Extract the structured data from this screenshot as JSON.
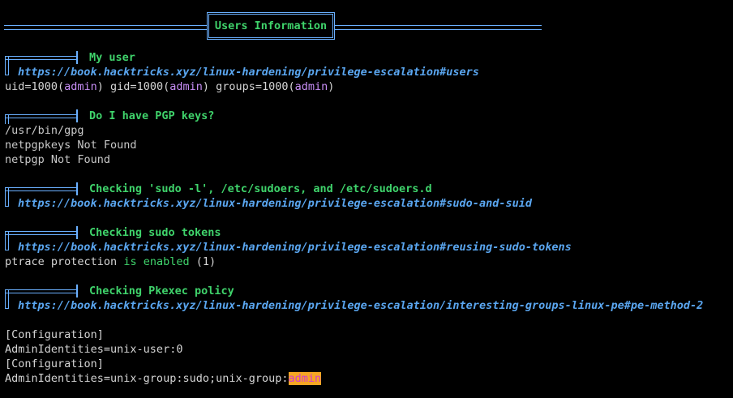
{
  "banner": {
    "title": "Users Information"
  },
  "sections": [
    {
      "title": "My user",
      "link": "https://book.hacktricks.xyz/linux-hardening/privilege-escalation#users",
      "output": {
        "uid_prefix": "uid=1000(",
        "uid_name": "admin",
        "gid_prefix": ") gid=1000(",
        "gid_name": "admin",
        "groups_prefix": ") groups=1000(",
        "groups_name": "admin",
        "suffix": ")"
      }
    },
    {
      "title": "Do I have PGP keys?",
      "lines": [
        "/usr/bin/gpg",
        "netpgpkeys Not Found",
        "netpgp Not Found"
      ]
    },
    {
      "title": "Checking 'sudo -l', /etc/sudoers, and /etc/sudoers.d",
      "link": "https://book.hacktricks.xyz/linux-hardening/privilege-escalation#sudo-and-suid"
    },
    {
      "title": "Checking sudo tokens",
      "link": "https://book.hacktricks.xyz/linux-hardening/privilege-escalation#reusing-sudo-tokens",
      "output": {
        "prefix": "ptrace protection ",
        "status": "is enabled",
        "suffix": " (1)"
      }
    },
    {
      "title": "Checking Pkexec policy",
      "link": "https://book.hacktricks.xyz/linux-hardening/privilege-escalation/interesting-groups-linux-pe#pe-method-2",
      "lines": [
        "[Configuration]",
        "AdminIdentities=unix-user:0",
        "[Configuration]"
      ],
      "last_line": {
        "prefix": "AdminIdentities=unix-group:sudo;unix-group:",
        "highlight": "admin"
      }
    }
  ],
  "colors": {
    "background": "#000000",
    "title_green": "#3fd36b",
    "link_blue": "#5aa6f0",
    "user_purple": "#c78ef5",
    "highlight_bg": "#f5a623",
    "highlight_fg": "#d23cc9"
  }
}
